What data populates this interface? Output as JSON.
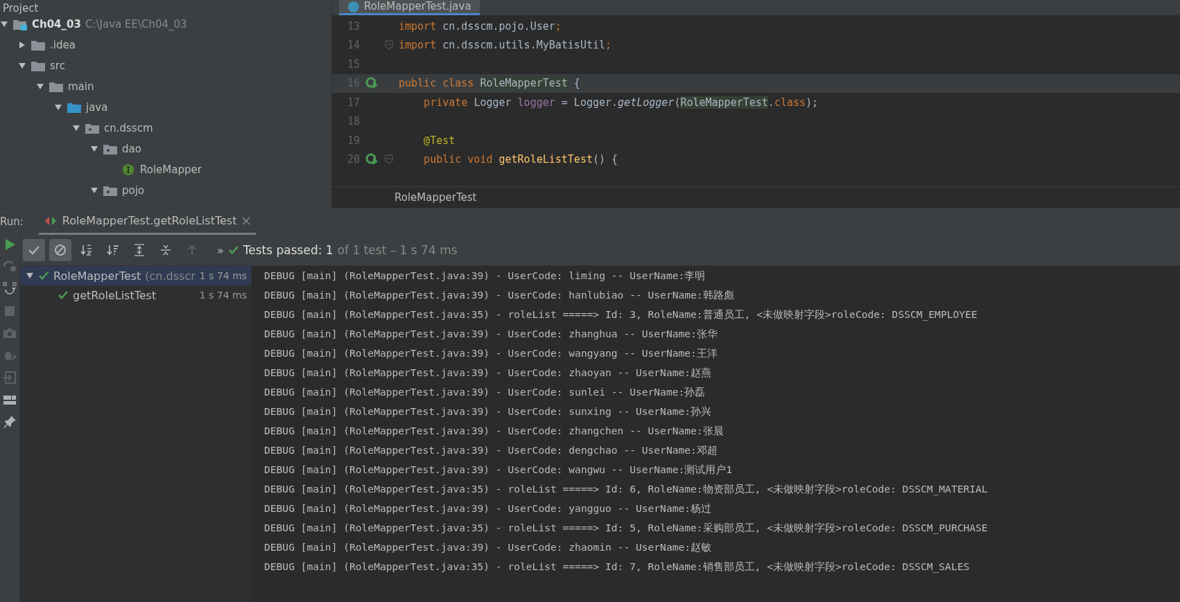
{
  "project_panel": {
    "title": "Project",
    "tree": [
      {
        "label": "Ch04_03",
        "path": "C:\\Java EE\\Ch04_03",
        "kind": "module",
        "expanded": true,
        "children": [
          {
            "label": ".idea",
            "kind": "folder",
            "expanded": false
          },
          {
            "label": "src",
            "kind": "folder",
            "expanded": true,
            "children": [
              {
                "label": "main",
                "kind": "folder",
                "expanded": true,
                "children": [
                  {
                    "label": "java",
                    "kind": "source-folder",
                    "expanded": true,
                    "children": [
                      {
                        "label": "cn.dsscm",
                        "kind": "package",
                        "expanded": true,
                        "children": [
                          {
                            "label": "dao",
                            "kind": "package",
                            "expanded": true,
                            "children": [
                              {
                                "label": "RoleMapper",
                                "kind": "interface"
                              }
                            ]
                          },
                          {
                            "label": "pojo",
                            "kind": "package",
                            "expanded": true
                          }
                        ]
                      }
                    ]
                  }
                ]
              }
            ]
          }
        ]
      }
    ]
  },
  "editor": {
    "tab": "RoleMapperTest.java",
    "lines": [
      {
        "number": "13",
        "current": false,
        "run": false,
        "fold": false,
        "segments": [
          {
            "text": "import ",
            "kind": "keyword"
          },
          {
            "text": "cn.dsscm.pojo.User",
            "kind": "plain"
          },
          {
            "text": ";",
            "kind": "keyword"
          }
        ]
      },
      {
        "number": "14",
        "current": false,
        "run": false,
        "fold": true,
        "segments": [
          {
            "text": "import ",
            "kind": "keyword"
          },
          {
            "text": "cn.dsscm.utils.MyBatisUtil",
            "kind": "plain"
          },
          {
            "text": ";",
            "kind": "keyword"
          }
        ]
      },
      {
        "number": "15",
        "current": false,
        "run": false,
        "fold": false
      },
      {
        "number": "16",
        "current": true,
        "run": true,
        "fold": false,
        "segments": [
          {
            "text": "public class ",
            "kind": "keyword"
          },
          {
            "text": "RoleMapperTest",
            "kind": "match"
          },
          {
            "text": " {",
            "kind": "plain"
          }
        ]
      },
      {
        "number": "17",
        "current": false,
        "run": false,
        "fold": false,
        "segments": [
          {
            "text": "    private ",
            "kind": "keyword"
          },
          {
            "text": "Logger ",
            "kind": "plain"
          },
          {
            "text": "logger",
            "kind": "field"
          },
          {
            "text": " = Logger.",
            "kind": "plain"
          },
          {
            "text": "getLogger",
            "kind": "static"
          },
          {
            "text": "(",
            "kind": "plain"
          },
          {
            "text": "RoleMapperTest",
            "kind": "match"
          },
          {
            "text": ".",
            "kind": "plain"
          },
          {
            "text": "class",
            "kind": "keyword"
          },
          {
            "text": ");",
            "kind": "plain"
          }
        ]
      },
      {
        "number": "18",
        "current": false,
        "run": false,
        "fold": false
      },
      {
        "number": "19",
        "current": false,
        "run": false,
        "fold": false,
        "segments": [
          {
            "text": "    @Test",
            "kind": "annotation"
          }
        ]
      },
      {
        "number": "20",
        "current": false,
        "run": true,
        "fold": true,
        "segments": [
          {
            "text": "    public void ",
            "kind": "keyword"
          },
          {
            "text": "getRoleListTest",
            "kind": "method"
          },
          {
            "text": "() {",
            "kind": "plain"
          }
        ]
      }
    ],
    "breadcrumb": "RoleMapperTest"
  },
  "run_panel": {
    "label": "Run:",
    "tab": "RoleMapperTest.getRoleListTest",
    "toolbar": [
      {
        "kind": "show-passed",
        "selected": true
      },
      {
        "kind": "show-ignored",
        "selected": true
      },
      {
        "kind": "sort-alpha",
        "selected": false
      },
      {
        "kind": "sort-duration",
        "selected": false
      },
      {
        "kind": "expand-all",
        "selected": false
      },
      {
        "kind": "collapse-all",
        "selected": false
      },
      {
        "kind": "previous",
        "selected": false
      }
    ],
    "more": "»",
    "status": {
      "label": "Tests passed: 1",
      "detail": "of 1 test – 1 s 74 ms"
    },
    "tests": [
      {
        "label": "RoleMapperTest",
        "detail": "(cn.dsscr",
        "time": "1 s 74 ms",
        "selected": true,
        "expanded": true,
        "children": [
          {
            "label": "getRoleListTest",
            "time": "1 s 74 ms",
            "selected": false
          }
        ]
      }
    ],
    "console": [
      "DEBUG [main] (RoleMapperTest.java:39) - UserCode: liming -- UserName:李明",
      "DEBUG [main] (RoleMapperTest.java:39) - UserCode: hanlubiao -- UserName:韩路彪",
      "DEBUG [main] (RoleMapperTest.java:35) - roleList =====> Id: 3, RoleName:普通员工, <未做映射字段>roleCode: DSSCM_EMPLOYEE",
      "DEBUG [main] (RoleMapperTest.java:39) - UserCode: zhanghua -- UserName:张华",
      "DEBUG [main] (RoleMapperTest.java:39) - UserCode: wangyang -- UserName:王洋",
      "DEBUG [main] (RoleMapperTest.java:39) - UserCode: zhaoyan -- UserName:赵燕",
      "DEBUG [main] (RoleMapperTest.java:39) - UserCode: sunlei -- UserName:孙磊",
      "DEBUG [main] (RoleMapperTest.java:39) - UserCode: sunxing -- UserName:孙兴",
      "DEBUG [main] (RoleMapperTest.java:39) - UserCode: zhangchen -- UserName:张晨",
      "DEBUG [main] (RoleMapperTest.java:39) - UserCode: dengchao -- UserName:邓超",
      "DEBUG [main] (RoleMapperTest.java:39) - UserCode: wangwu -- UserName:测试用户1",
      "DEBUG [main] (RoleMapperTest.java:35) - roleList =====> Id: 6, RoleName:物资部员工, <未做映射字段>roleCode: DSSCM_MATERIAL",
      "DEBUG [main] (RoleMapperTest.java:39) - UserCode: yangguo -- UserName:杨过",
      "DEBUG [main] (RoleMapperTest.java:35) - roleList =====> Id: 5, RoleName:采购部员工, <未做映射字段>roleCode: DSSCM_PURCHASE",
      "DEBUG [main] (RoleMapperTest.java:39) - UserCode: zhaomin -- UserName:赵敏",
      "DEBUG [main] (RoleMapperTest.java:35) - roleList =====> Id: 7, RoleName:销售部员工, <未做映射字段>roleCode: DSSCM_SALES"
    ]
  }
}
